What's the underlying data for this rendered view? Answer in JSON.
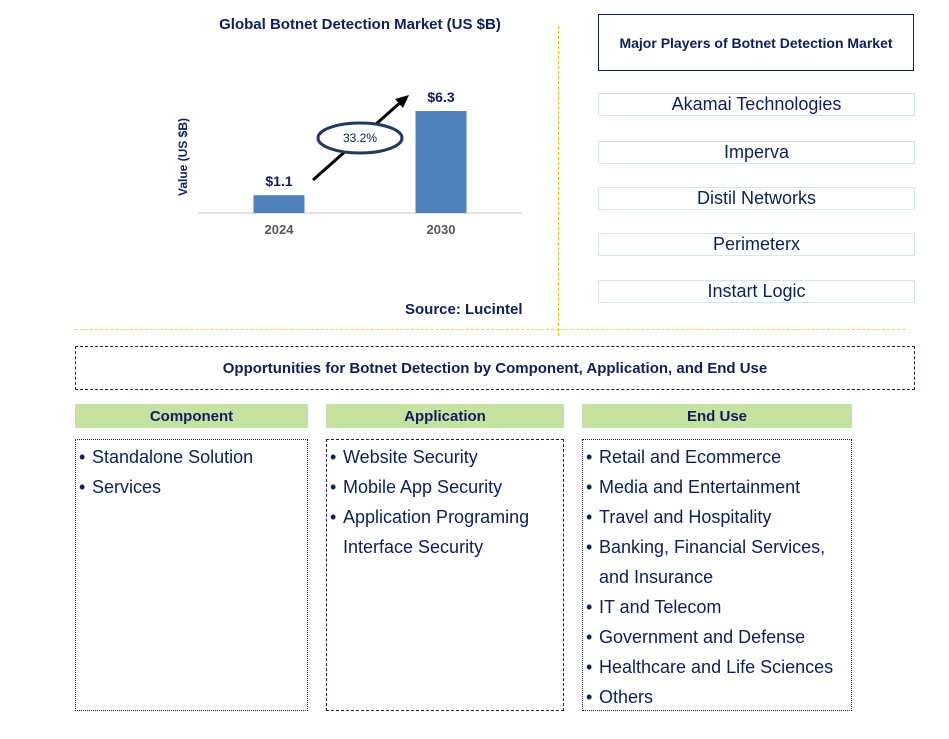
{
  "chart_data": {
    "type": "bar",
    "title": "Global Botnet Detection Market (US $B)",
    "xlabel": "",
    "ylabel": "Value (US $B)",
    "categories": [
      "2024",
      "2030"
    ],
    "values": [
      1.1,
      6.3
    ],
    "data_labels": [
      "$1.1",
      "$6.3"
    ],
    "ylim": [
      0,
      6.3
    ],
    "grid": false,
    "annotation": {
      "text": "33.2%",
      "meaning": "CAGR",
      "shape": "ellipse-with-arrow"
    },
    "colors": {
      "bar": "#4f81bd",
      "text": "#0d1f5c",
      "tick": "#595959"
    }
  },
  "source": "Source: Lucintel",
  "players": {
    "title": "Major Players of Botnet Detection Market",
    "items": [
      "Akamai Technologies",
      "Imperva",
      "Distil Networks",
      "Perimeterx",
      "Instart Logic"
    ]
  },
  "opportunities": {
    "title": "Opportunities for Botnet Detection by Component, Application, and End Use",
    "categories": [
      {
        "header": "Component",
        "items": [
          [
            "Standalone Solution"
          ],
          [
            "Services"
          ]
        ]
      },
      {
        "header": "Application",
        "items": [
          [
            "Website Security"
          ],
          [
            "Mobile App Security"
          ],
          [
            "Application Programing",
            "Interface Security"
          ]
        ]
      },
      {
        "header": "End Use",
        "items": [
          [
            "Retail and Ecommerce"
          ],
          [
            "Media and Entertainment"
          ],
          [
            "Travel and Hospitality"
          ],
          [
            "Banking, Financial Services,",
            "and Insurance"
          ],
          [
            "IT and Telecom"
          ],
          [
            "Government and Defense"
          ],
          [
            "Healthcare and Life Sciences"
          ],
          [
            "Others"
          ]
        ]
      }
    ]
  },
  "colors": {
    "header_green": "#c6e2a0",
    "navy": "#0d1f5c",
    "divider_gold": "#f5b800",
    "player_border": "#d3e6f3"
  }
}
